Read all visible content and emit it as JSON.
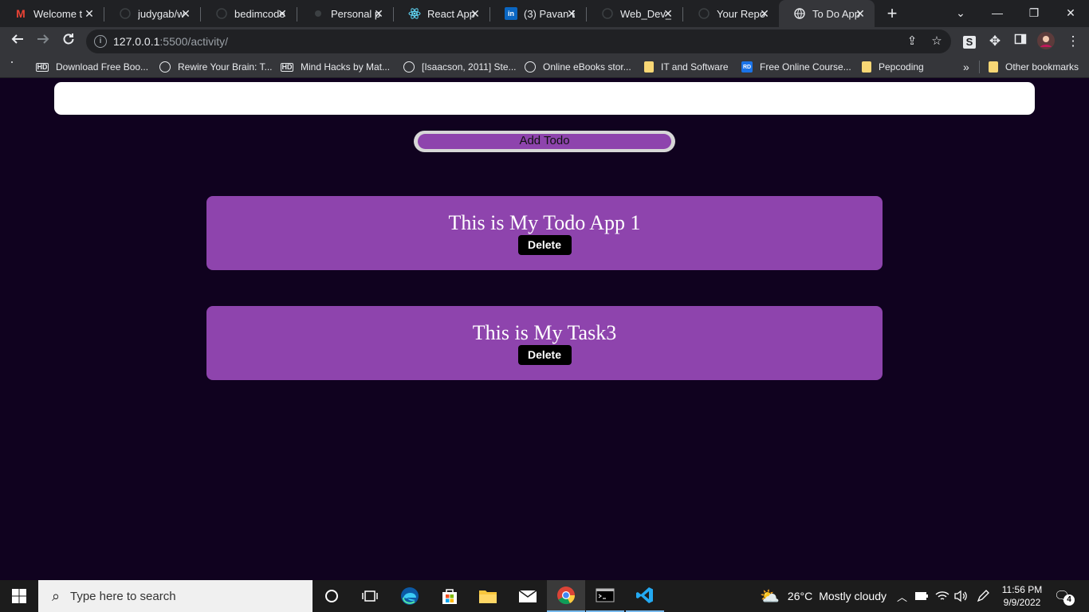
{
  "browser": {
    "tabs": [
      {
        "title": "Welcome t",
        "icon": "gmail-icon"
      },
      {
        "title": "judygab/w",
        "icon": "github-icon"
      },
      {
        "title": "bedimcode",
        "icon": "github-icon"
      },
      {
        "title": "Personal p",
        "icon": "dot-icon"
      },
      {
        "title": "React App",
        "icon": "react-icon"
      },
      {
        "title": "(3) Pavan B",
        "icon": "linkedin-icon"
      },
      {
        "title": "Web_Dev_",
        "icon": "github-icon"
      },
      {
        "title": "Your Repo",
        "icon": "github-icon"
      },
      {
        "title": "To Do App",
        "icon": "globe-icon",
        "active": true
      }
    ],
    "url_host": "127.0.0.1",
    "url_path": ":5500/activity/",
    "bookmarks": [
      {
        "label": "Download Free Boo...",
        "icon": "hd-icon"
      },
      {
        "label": "Rewire Your Brain: T...",
        "icon": "globe-icon"
      },
      {
        "label": "Mind Hacks by Mat...",
        "icon": "hd-icon"
      },
      {
        "label": "[Isaacson, 2011] Ste...",
        "icon": "globe-icon"
      },
      {
        "label": "Online eBooks stor...",
        "icon": "globe-icon"
      },
      {
        "label": "IT and Software",
        "icon": "folder-icon"
      },
      {
        "label": "Free Online Course...",
        "icon": "rd-icon"
      },
      {
        "label": "Pepcoding",
        "icon": "folder-icon"
      }
    ],
    "overflow_label": "»",
    "other_bookmarks": "Other bookmarks"
  },
  "app": {
    "input_value": "",
    "add_button_label": "Add Todo",
    "todos": [
      {
        "text": "This is My Todo App 1",
        "delete_label": "Delete"
      },
      {
        "text": "This is My Task3",
        "delete_label": "Delete"
      }
    ],
    "colors": {
      "background": "#10021f",
      "card": "#8e44ad",
      "delete_button": "#000000"
    }
  },
  "taskbar": {
    "search_placeholder": "Type here to search",
    "weather_temp": "26°C",
    "weather_desc": "Mostly cloudy",
    "time": "11:56 PM",
    "date": "9/9/2022",
    "notification_count": "4"
  }
}
